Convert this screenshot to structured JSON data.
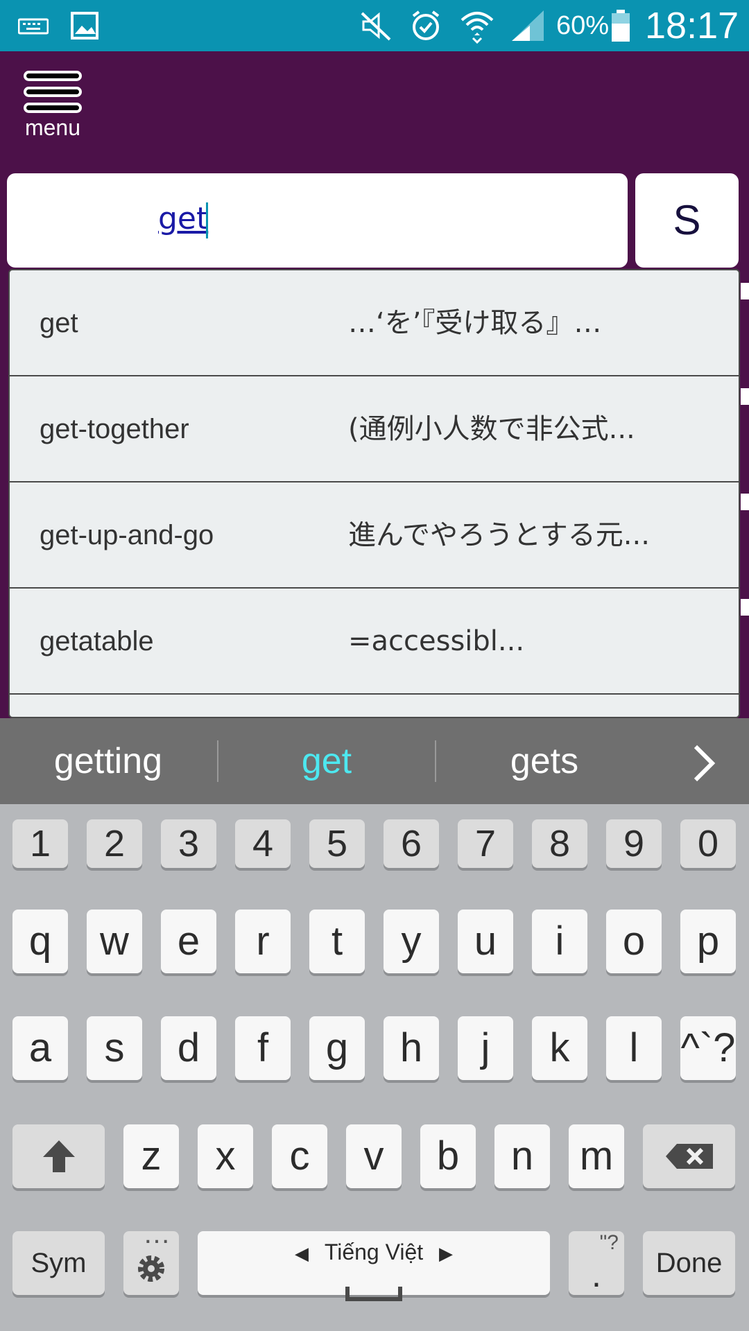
{
  "status_bar": {
    "battery": "60%",
    "time": "18:17",
    "icons": [
      "keyboard-icon",
      "image-icon",
      "mute-icon",
      "alarm-icon",
      "wifi-icon",
      "signal-icon",
      "battery-icon"
    ]
  },
  "header": {
    "menu_label": "menu"
  },
  "search": {
    "value": "get",
    "button_label": "S"
  },
  "suggestions": [
    {
      "word": "get",
      "definition": "…‘を’『受け取る』…"
    },
    {
      "word": "get-together",
      "definition": "(通例小人数で非公式..."
    },
    {
      "word": "get-up-and-go",
      "definition": "進んでやろうとする元..."
    },
    {
      "word": "getatable",
      "definition": "=accessibl..."
    }
  ],
  "keyboard": {
    "predictions": [
      "getting",
      "get",
      "gets"
    ],
    "number_row": [
      "1",
      "2",
      "3",
      "4",
      "5",
      "6",
      "7",
      "8",
      "9",
      "0"
    ],
    "row1": [
      "q",
      "w",
      "e",
      "r",
      "t",
      "y",
      "u",
      "i",
      "o",
      "p"
    ],
    "row2": [
      "a",
      "s",
      "d",
      "f",
      "g",
      "h",
      "j",
      "k",
      "l",
      "^`?"
    ],
    "row3": [
      "z",
      "x",
      "c",
      "v",
      "b",
      "n",
      "m"
    ],
    "sym_label": "Sym",
    "language_label": "Tiếng Việt",
    "period_label": ".",
    "period_extra": "\"?",
    "done_label": "Done",
    "accent_color": "#4de8f0"
  }
}
